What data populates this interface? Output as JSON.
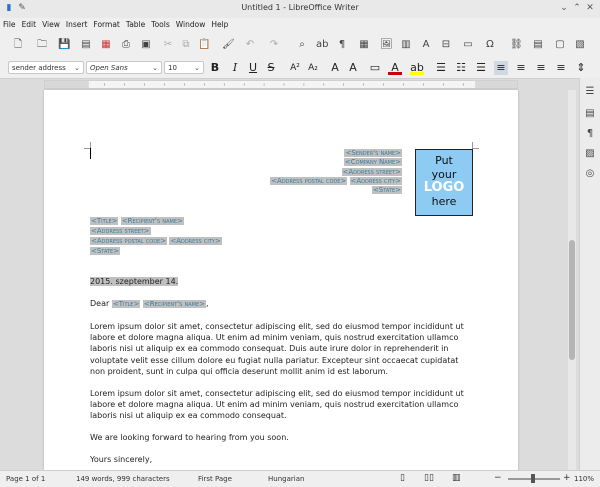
{
  "window": {
    "title": "Untitled 1 - LibreOffice Writer"
  },
  "menu": [
    "File",
    "Edit",
    "View",
    "Insert",
    "Format",
    "Table",
    "Tools",
    "Window",
    "Help"
  ],
  "format_bar": {
    "paragraph_style": "sender address",
    "font_name": "Open Sans",
    "font_size": "10"
  },
  "document": {
    "sender_lines": [
      [
        "<Sender's name>"
      ],
      [
        "<Company Name>"
      ],
      [
        "<Address street>"
      ],
      [
        "<Address postal code>",
        "<Address city>"
      ],
      [
        "<State>"
      ]
    ],
    "logo": {
      "line1": "Put",
      "line2": "your",
      "line3": "LOGO",
      "line4": "here"
    },
    "recipient_lines": [
      [
        "<Title>",
        "<Recipient's name>"
      ],
      [
        "<Address street>"
      ],
      [
        "<Address postal code>",
        "<Address city>"
      ],
      [
        "<State>"
      ]
    ],
    "date": "2015. szeptember 14.",
    "salutation_prefix": "Dear",
    "salutation_title": "<Title>",
    "salutation_name": "<Recipient's name>",
    "salutation_suffix": ",",
    "para1": "Lorem ipsum dolor sit amet, consectetur adipiscing elit, sed do eiusmod tempor incididunt ut labore et dolore magna aliqua. Ut enim ad minim veniam, quis nostrud exercitation ullamco laboris nisi ut aliquip ex ea commodo consequat. Duis aute irure dolor in reprehenderit in voluptate velit esse cillum dolore eu fugiat nulla pariatur. Excepteur sint occaecat cupidatat non proident, sunt in culpa qui officia deserunt mollit anim id est laborum.",
    "para2": "Lorem ipsum dolor sit amet, consectetur adipiscing elit, sed do eiusmod tempor incididunt ut labore et dolore magna aliqua. Ut enim ad minim veniam, quis nostrud exercitation ullamco laboris nisi ut aliquip ex ea commodo consequat.",
    "para3": "We are looking forward to hearing from you soon.",
    "closing": "Yours sincerely,"
  },
  "status": {
    "page": "Page 1 of 1",
    "words": "149 words, 999 characters",
    "page_style": "First Page",
    "language": "Hungarian",
    "zoom": "110%"
  },
  "colors": {
    "field_bg": "#c0c0c0",
    "field_text": "#3a7d9d",
    "logo_bg": "#8ecbf2"
  }
}
